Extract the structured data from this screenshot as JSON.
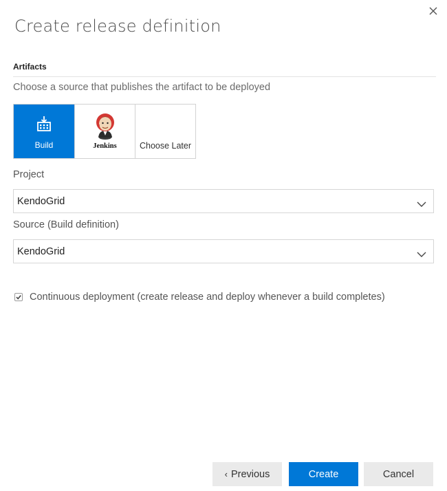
{
  "dialog": {
    "title": "Create release definition",
    "close_icon": "close-icon"
  },
  "artifacts": {
    "section_label": "Artifacts",
    "subtitle": "Choose a source that publishes the artifact to be deployed",
    "sources": [
      {
        "label": "Build",
        "icon": "build-icon",
        "selected": true
      },
      {
        "label": "Jenkins",
        "icon": "jenkins-logo",
        "selected": false
      },
      {
        "label": "Choose Later",
        "icon": "",
        "selected": false
      }
    ]
  },
  "project": {
    "label": "Project",
    "value": "KendoGrid"
  },
  "source": {
    "label": "Source (Build definition)",
    "value": "KendoGrid"
  },
  "continuous_deployment": {
    "checked": true,
    "label": "Continuous deployment (create release and deploy whenever a build completes)"
  },
  "footer": {
    "previous_label": "Previous",
    "previous_icon": "chevron-left-icon",
    "create_label": "Create",
    "cancel_label": "Cancel"
  },
  "colors": {
    "accent": "#0078d7",
    "secondary_button": "#eaeaea",
    "border": "#d6d6d6"
  }
}
